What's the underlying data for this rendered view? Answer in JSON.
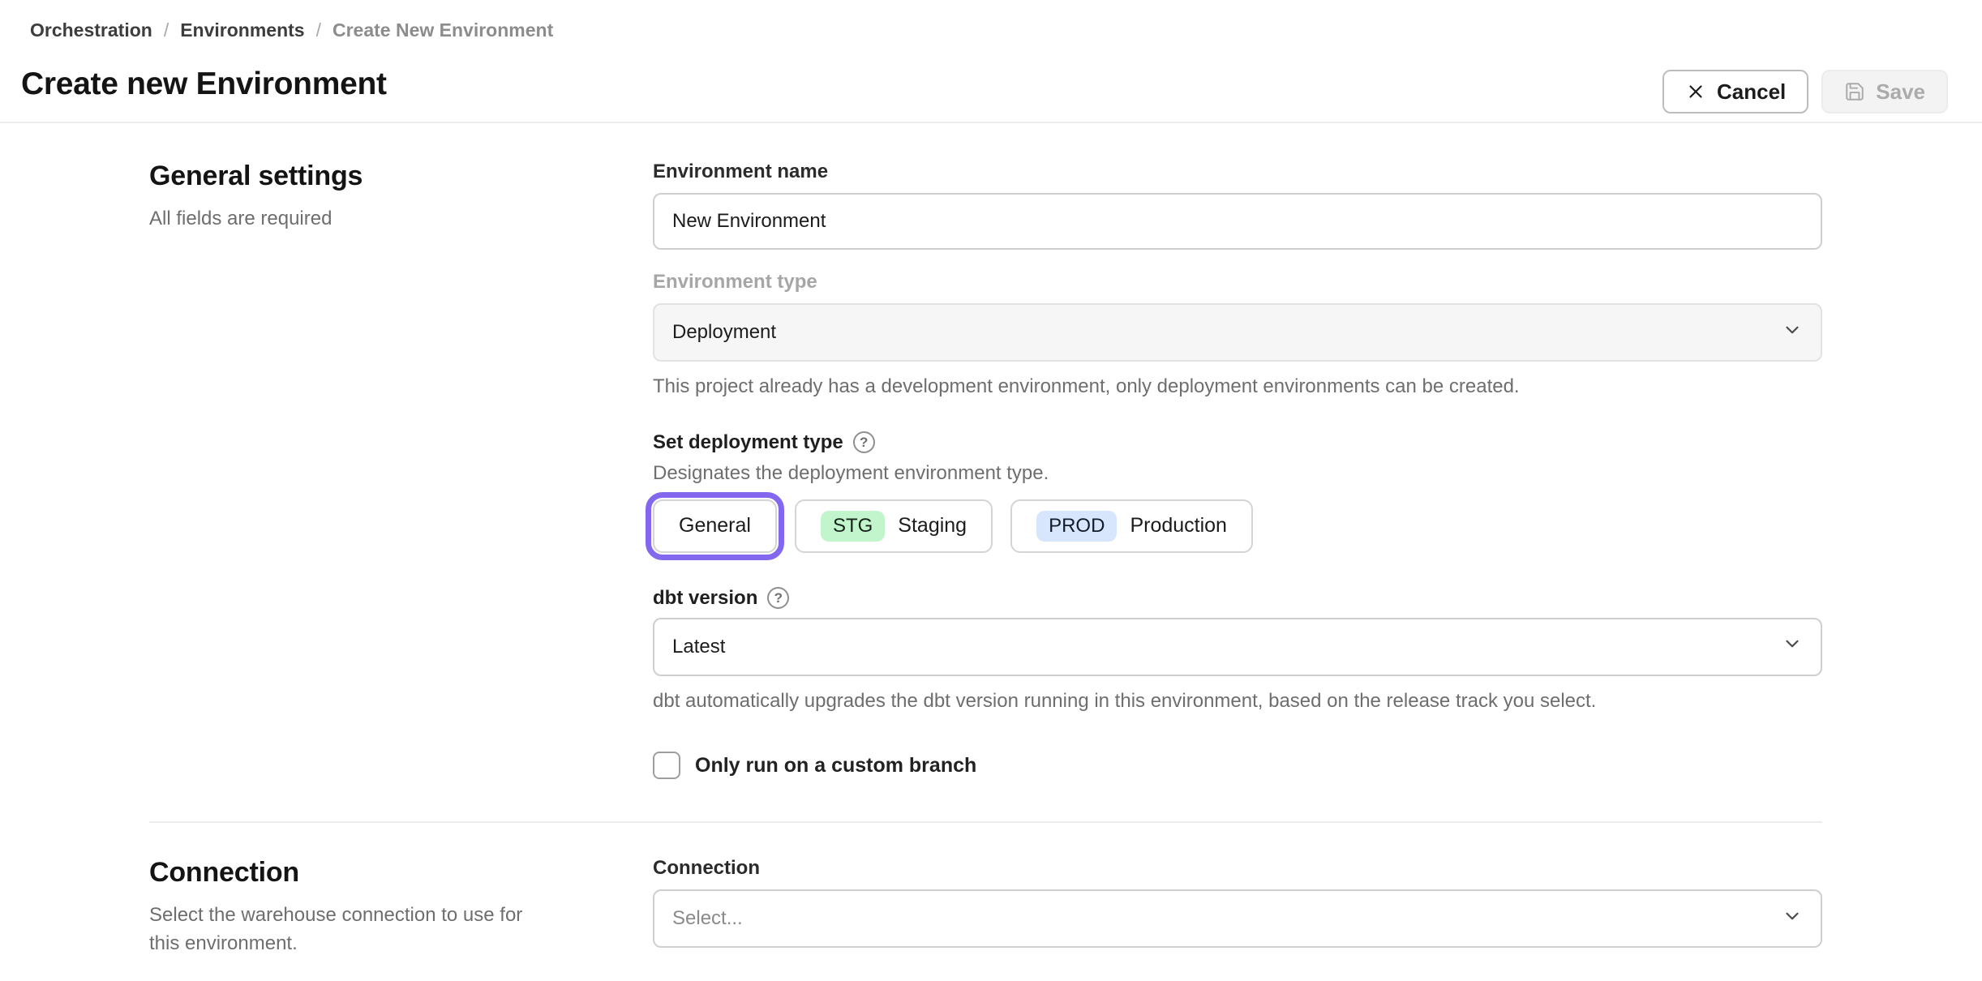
{
  "breadcrumb": {
    "items": [
      "Orchestration",
      "Environments",
      "Create New Environment"
    ],
    "separator": "/"
  },
  "header": {
    "title": "Create new Environment",
    "cancel_label": "Cancel",
    "save_label": "Save"
  },
  "general": {
    "heading": "General settings",
    "subheading": "All fields are required",
    "env_name": {
      "label": "Environment name",
      "value": "New Environment"
    },
    "env_type": {
      "label": "Environment type",
      "value": "Deployment",
      "helper": "This project already has a development environment, only deployment environments can be created."
    },
    "deployment_type": {
      "label": "Set deployment type",
      "helper": "Designates the deployment environment type.",
      "options": [
        {
          "label": "General",
          "badge": "",
          "selected": true
        },
        {
          "label": "Staging",
          "badge": "STG",
          "selected": false
        },
        {
          "label": "Production",
          "badge": "PROD",
          "selected": false
        }
      ]
    },
    "dbt_version": {
      "label": "dbt version",
      "value": "Latest",
      "helper": "dbt automatically upgrades the dbt version running in this environment, based on the release track you select."
    },
    "custom_branch": {
      "label": "Only run on a custom branch",
      "checked": false
    }
  },
  "connection": {
    "heading": "Connection",
    "description": "Select the warehouse connection to use for this environment.",
    "field": {
      "label": "Connection",
      "placeholder": "Select..."
    }
  },
  "colors": {
    "accent": "#8467ef",
    "badge_stg": "#c2f5cb",
    "badge_prod": "#d8e6fd",
    "text_dark": "#1c1c1c",
    "text_gray": "#6e6e6e",
    "text_disabled": "#a6a6a6"
  }
}
